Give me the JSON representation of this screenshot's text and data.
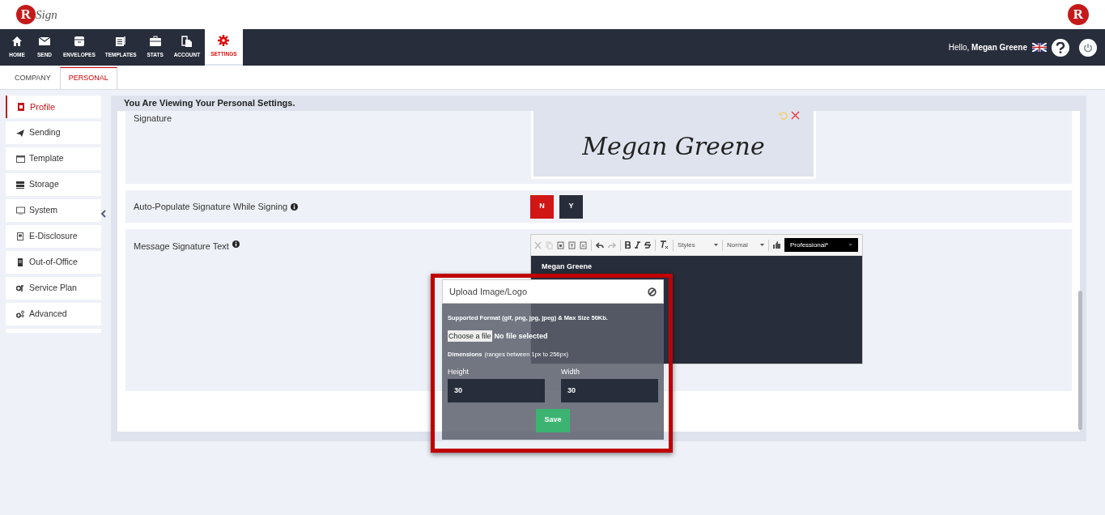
{
  "header": {
    "logo_letter": "R",
    "logo_text": "Sign",
    "brand_mark": "R"
  },
  "nav": [
    {
      "label": "HOME",
      "selected": false
    },
    {
      "label": "SEND",
      "selected": false
    },
    {
      "label": "ENVELOPES",
      "selected": false
    },
    {
      "label": "TEMPLATES",
      "selected": false
    },
    {
      "label": "STATS",
      "selected": false
    },
    {
      "label": "ACCOUNT",
      "selected": false
    },
    {
      "label": "SETTINGS",
      "selected": true
    }
  ],
  "user": {
    "greeting": "Hello,",
    "name": "Megan Greene"
  },
  "tabs": [
    {
      "label": "COMPANY",
      "selected": false
    },
    {
      "label": "PERSONAL",
      "selected": true
    }
  ],
  "sidebar": [
    {
      "label": "Profile",
      "selected": true
    },
    {
      "label": "Sending",
      "selected": false
    },
    {
      "label": "Template",
      "selected": false
    },
    {
      "label": "Storage",
      "selected": false
    },
    {
      "label": "System",
      "selected": false
    },
    {
      "label": "E-Disclosure",
      "selected": false
    },
    {
      "label": "Out-of-Office",
      "selected": false
    },
    {
      "label": "Service Plan",
      "selected": false
    },
    {
      "label": "Advanced",
      "selected": false
    }
  ],
  "panel_title": "You Are Viewing Your Personal Settings.",
  "signature": {
    "label": "Signature",
    "image_text": "Megan Greene"
  },
  "auto_populate": {
    "label": "Auto-Populate Signature While Signing",
    "options": [
      {
        "label": "N",
        "selected": true
      },
      {
        "label": "Y",
        "selected": false
      }
    ]
  },
  "message_signature": {
    "label": "Message Signature Text",
    "toolbar": {
      "styles": "Styles",
      "format": "Normal",
      "template": "Professional*"
    },
    "content": "Megan Greene"
  },
  "modal": {
    "title": "Upload Image/Logo",
    "formats": "Supported Format (gif, png, jpg, jpeg) & Max Size 50Kb.",
    "file_button": "Choose a file",
    "file_status": "No file selected",
    "dimensions": "Dimensions",
    "dimensions_hint": "(ranges between 1px to 256px)",
    "fields": [
      {
        "label": "Height",
        "value": "30"
      },
      {
        "label": "Width",
        "value": "30"
      }
    ],
    "save": "Save"
  }
}
